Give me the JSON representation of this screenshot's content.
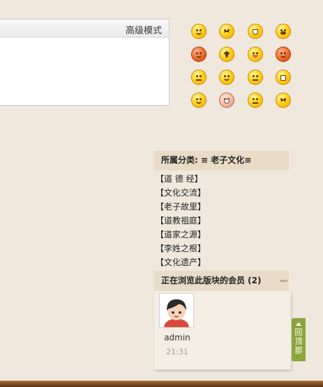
{
  "editor": {
    "mode_label": "高级模式"
  },
  "smilies": [
    "smile",
    "sad",
    "biggrin",
    "cry",
    "angry",
    "surprised",
    "tongue",
    "wink",
    "thinking",
    "laugh",
    "huffy",
    "grin",
    "shy",
    "titter",
    "sweat",
    "mad"
  ],
  "category": {
    "title": "所属分类: ≡ 老子文化≡",
    "items": [
      "【道 德 经】",
      "【文化交流】",
      "【老子故里】",
      "【道教祖庭】",
      "【道家之源】",
      "【李姓之根】",
      "【文化遗产】"
    ]
  },
  "members": {
    "title": "正在浏览此版块的会员 (2)",
    "list": [
      {
        "name": "admin",
        "time": "21:31"
      }
    ]
  },
  "back_to_top": {
    "label": "回顶部"
  }
}
